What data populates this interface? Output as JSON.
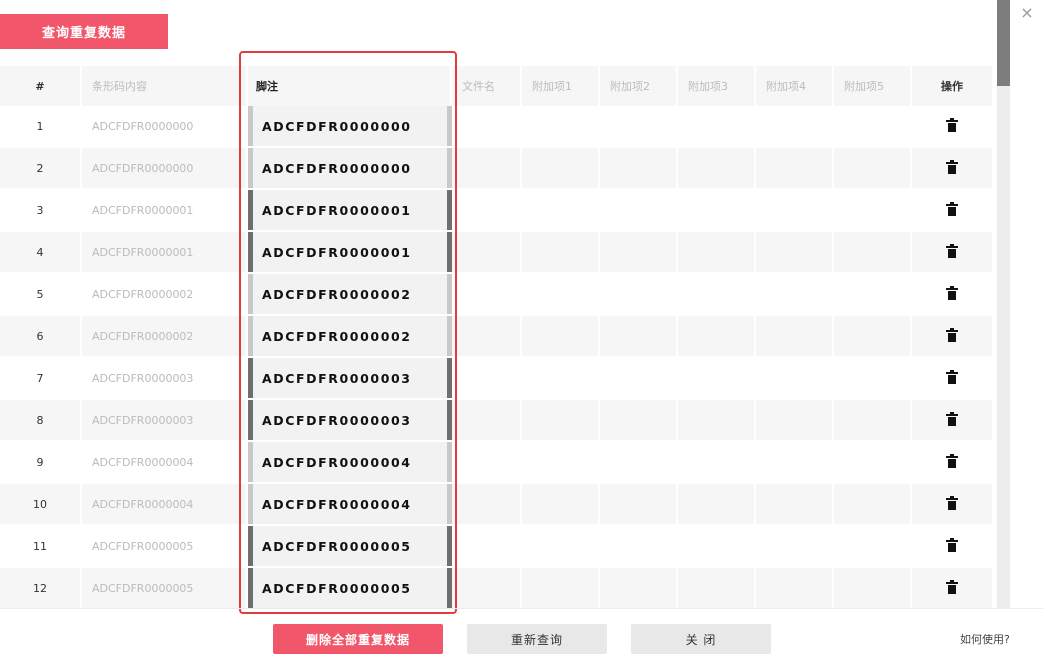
{
  "top_button": "查询重复数据",
  "close_icon": "×",
  "columns": {
    "index": "#",
    "code": "条形码内容",
    "note": "脚注",
    "file": "文件名",
    "ext1": "附加项1",
    "ext2": "附加项2",
    "ext3": "附加项3",
    "ext4": "附加项4",
    "ext5": "附加项5",
    "op": "操作"
  },
  "rows": [
    {
      "index": "1",
      "code": "ADCFDFR0000000",
      "note": "ADCFDFR0000000"
    },
    {
      "index": "2",
      "code": "ADCFDFR0000000",
      "note": "ADCFDFR0000000"
    },
    {
      "index": "3",
      "code": "ADCFDFR0000001",
      "note": "ADCFDFR0000001"
    },
    {
      "index": "4",
      "code": "ADCFDFR0000001",
      "note": "ADCFDFR0000001"
    },
    {
      "index": "5",
      "code": "ADCFDFR0000002",
      "note": "ADCFDFR0000002"
    },
    {
      "index": "6",
      "code": "ADCFDFR0000002",
      "note": "ADCFDFR0000002"
    },
    {
      "index": "7",
      "code": "ADCFDFR0000003",
      "note": "ADCFDFR0000003"
    },
    {
      "index": "8",
      "code": "ADCFDFR0000003",
      "note": "ADCFDFR0000003"
    },
    {
      "index": "9",
      "code": "ADCFDFR0000004",
      "note": "ADCFDFR0000004"
    },
    {
      "index": "10",
      "code": "ADCFDFR0000004",
      "note": "ADCFDFR0000004"
    },
    {
      "index": "11",
      "code": "ADCFDFR0000005",
      "note": "ADCFDFR0000005"
    },
    {
      "index": "12",
      "code": "ADCFDFR0000005",
      "note": "ADCFDFR0000005"
    }
  ],
  "row_icon": "trash-icon",
  "footer": {
    "delete_all": "删除全部重复数据",
    "requery": "重新查询",
    "close": "关 闭",
    "help": "如何使用?"
  },
  "colors": {
    "accent": "#f2566b",
    "highlight": "#e23b3b"
  }
}
